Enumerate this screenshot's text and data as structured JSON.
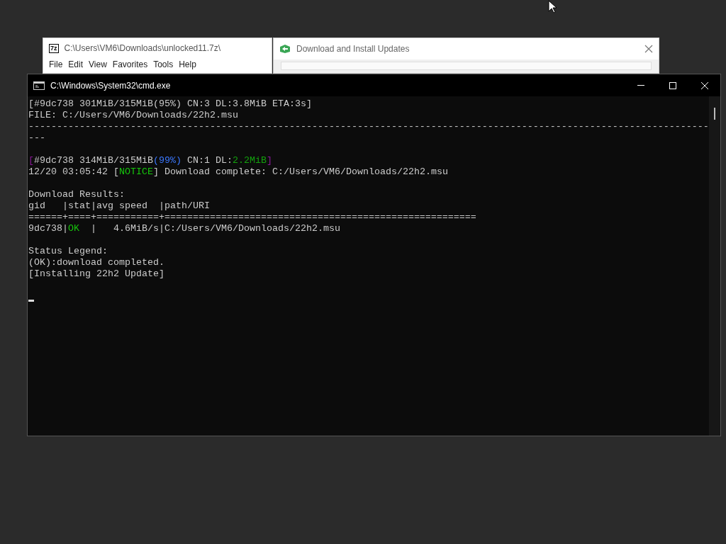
{
  "background_windows": [
    {
      "kind": "archive",
      "icon_text": "7z",
      "title": "C:\\Users\\VM6\\Downloads\\unlocked11.7z\\",
      "menu": [
        "File",
        "Edit",
        "View",
        "Favorites",
        "Tools",
        "Help"
      ]
    },
    {
      "kind": "dialog",
      "title": "Download and Install Updates"
    }
  ],
  "console": {
    "title": "C:\\Windows\\System32\\cmd.exe",
    "lines": [
      {
        "kind": "text",
        "segments": [
          {
            "text": "[#9dc738 301MiB/315MiB(95%) CN:3 DL:3.8MiB ETA:3s]"
          }
        ]
      },
      {
        "kind": "text",
        "segments": [
          {
            "text": "FILE: C:/Users/VM6/Downloads/22h2.msu"
          }
        ]
      },
      {
        "kind": "text",
        "segments": [
          {
            "text": "------------------------------------------------------------------------------------------------------------------------"
          }
        ]
      },
      {
        "kind": "text",
        "segments": [
          {
            "text": "---"
          }
        ]
      },
      {
        "kind": "blank"
      },
      {
        "kind": "text",
        "segments": [
          {
            "text": "[",
            "color": "#881798"
          },
          {
            "text": "#9dc738 314MiB/315MiB"
          },
          {
            "text": "(99%)",
            "color": "#3b78ff"
          },
          {
            "text": " CN:1 DL:"
          },
          {
            "text": "2.2MiB",
            "color": "#13a10e"
          },
          {
            "text": "]",
            "color": "#881798"
          }
        ]
      },
      {
        "kind": "text",
        "segments": [
          {
            "text": "12/20 03:05:42 ["
          },
          {
            "text": "NOTICE",
            "color": "#16c60c"
          },
          {
            "text": "] Download complete: C:/Users/VM6/Downloads/22h2.msu"
          }
        ]
      },
      {
        "kind": "blank"
      },
      {
        "kind": "text",
        "segments": [
          {
            "text": "Download Results:"
          }
        ]
      },
      {
        "kind": "text",
        "segments": [
          {
            "text": "gid   |stat|avg speed  |path/URI"
          }
        ]
      },
      {
        "kind": "text",
        "segments": [
          {
            "text": "======+====+===========+======================================================="
          }
        ]
      },
      {
        "kind": "text",
        "segments": [
          {
            "text": "9dc738|"
          },
          {
            "text": "OK",
            "color": "#16c60c"
          },
          {
            "text": "  |   4.6MiB/s|C:/Users/VM6/Downloads/22h2.msu"
          }
        ]
      },
      {
        "kind": "blank"
      },
      {
        "kind": "text",
        "segments": [
          {
            "text": "Status Legend:"
          }
        ]
      },
      {
        "kind": "text",
        "segments": [
          {
            "text": "(OK):download completed."
          }
        ]
      },
      {
        "kind": "text",
        "segments": [
          {
            "text": "[Installing 22h2 Update]"
          }
        ]
      },
      {
        "kind": "blank"
      },
      {
        "kind": "cursor"
      }
    ]
  }
}
